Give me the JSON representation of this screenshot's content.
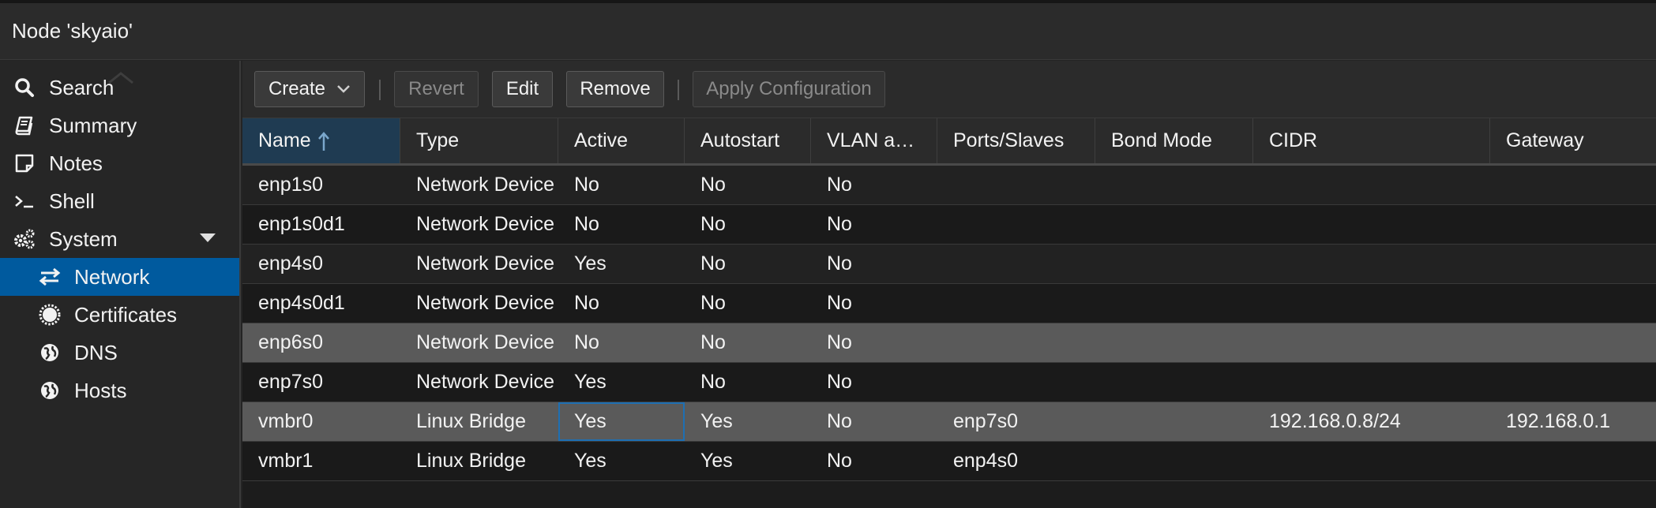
{
  "title": "Node 'skyaio'",
  "sidebar": {
    "items": [
      {
        "label": "Search",
        "icon": "search-icon"
      },
      {
        "label": "Summary",
        "icon": "book-icon"
      },
      {
        "label": "Notes",
        "icon": "note-icon"
      },
      {
        "label": "Shell",
        "icon": "terminal-icon"
      },
      {
        "label": "System",
        "icon": "gears-icon"
      },
      {
        "label": "Network",
        "icon": "exchange-icon"
      },
      {
        "label": "Certificates",
        "icon": "certificate-icon"
      },
      {
        "label": "DNS",
        "icon": "globe-icon"
      },
      {
        "label": "Hosts",
        "icon": "globe-icon"
      }
    ]
  },
  "toolbar": {
    "create": "Create",
    "revert": "Revert",
    "edit": "Edit",
    "remove": "Remove",
    "apply": "Apply Configuration"
  },
  "grid": {
    "columns": [
      "Name",
      "Type",
      "Active",
      "Autostart",
      "VLAN a…",
      "Ports/Slaves",
      "Bond Mode",
      "CIDR",
      "Gateway"
    ],
    "rows": [
      {
        "name": "enp1s0",
        "type": "Network Device",
        "active": "No",
        "autostart": "No",
        "vlan": "No",
        "ports": "",
        "bond": "",
        "cidr": "",
        "gateway": ""
      },
      {
        "name": "enp1s0d1",
        "type": "Network Device",
        "active": "No",
        "autostart": "No",
        "vlan": "No",
        "ports": "",
        "bond": "",
        "cidr": "",
        "gateway": ""
      },
      {
        "name": "enp4s0",
        "type": "Network Device",
        "active": "Yes",
        "autostart": "No",
        "vlan": "No",
        "ports": "",
        "bond": "",
        "cidr": "",
        "gateway": ""
      },
      {
        "name": "enp4s0d1",
        "type": "Network Device",
        "active": "No",
        "autostart": "No",
        "vlan": "No",
        "ports": "",
        "bond": "",
        "cidr": "",
        "gateway": ""
      },
      {
        "name": "enp6s0",
        "type": "Network Device",
        "active": "No",
        "autostart": "No",
        "vlan": "No",
        "ports": "",
        "bond": "",
        "cidr": "",
        "gateway": ""
      },
      {
        "name": "enp7s0",
        "type": "Network Device",
        "active": "Yes",
        "autostart": "No",
        "vlan": "No",
        "ports": "",
        "bond": "",
        "cidr": "",
        "gateway": ""
      },
      {
        "name": "vmbr0",
        "type": "Linux Bridge",
        "active": "Yes",
        "autostart": "Yes",
        "vlan": "No",
        "ports": "enp7s0",
        "bond": "",
        "cidr": "192.168.0.8/24",
        "gateway": "192.168.0.1"
      },
      {
        "name": "vmbr1",
        "type": "Linux Bridge",
        "active": "Yes",
        "autostart": "Yes",
        "vlan": "No",
        "ports": "enp4s0",
        "bond": "",
        "cidr": "",
        "gateway": ""
      }
    ]
  },
  "colors": {
    "accent": "#005a9e",
    "sorted_header": "#1f3b52",
    "focus": "#1e6fb3"
  }
}
